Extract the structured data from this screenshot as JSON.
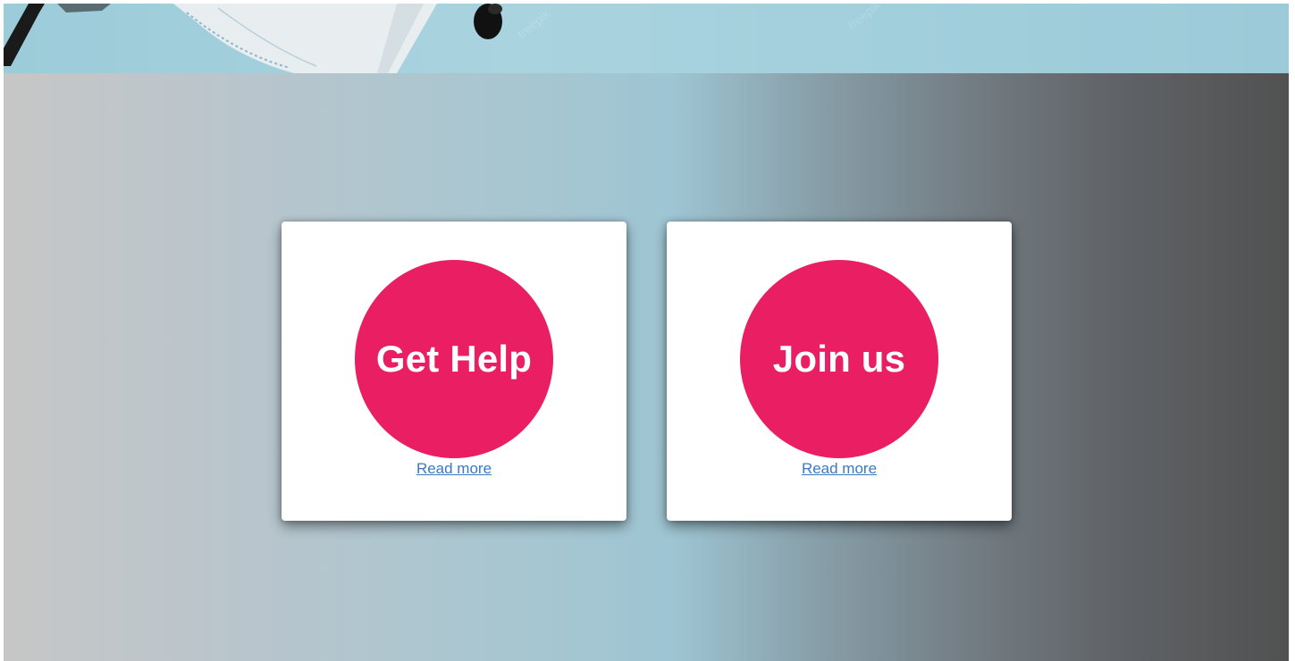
{
  "hero": {
    "image": "medical-supplies-photo"
  },
  "cards": [
    {
      "title": "Get Help",
      "link_label": "Read more"
    },
    {
      "title": "Join us",
      "link_label": "Read more"
    }
  ],
  "colors": {
    "circle": "#e91e63",
    "link": "#3a78c4",
    "card_bg": "#ffffff",
    "gradient_left": "#c6c6c6",
    "gradient_mid": "#9ec5d3",
    "gradient_right": "#515151"
  }
}
